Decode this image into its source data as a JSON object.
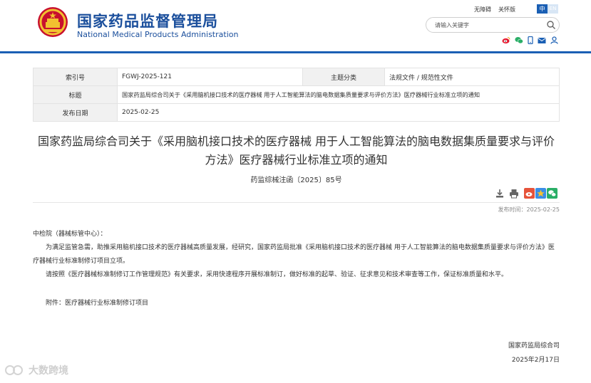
{
  "header": {
    "title_cn": "国家药品监督管理局",
    "title_en": "National Medical Products Administration",
    "link_accessibility": "无障碍",
    "link_old_version": "关怀版",
    "lang_zh": "中",
    "lang_en": "EN",
    "search_placeholder": "请输入关键字",
    "brand_color": "#1b4f9c"
  },
  "info": {
    "index_label": "索引号",
    "index_value": "FGWJ-2025-121",
    "category_label": "主题分类",
    "category_value": "法规文件 / 规范性文件",
    "subject_label": "标题",
    "subject_value": "国家药监局综合司关于《采用脑机接口技术的医疗器械 用于人工智能算法的脑电数据集质量要求与评价方法》医疗器械行业标准立项的通知",
    "date_label": "发布日期",
    "date_value": "2025-02-25"
  },
  "article": {
    "title_line1": "国家药监局综合司关于《采用脑机接口技术的医疗器械 用于人工智能算法的脑电数据集质量要求与评价",
    "title_line2": "方法》医疗器械行业标准立项的通知",
    "doc_number": "药监综械注函〔2025〕85号",
    "publish_time": "发布时间：2025-02-25",
    "salutation": "中检院（器械标管中心）：",
    "paragraph1": "为满足监管急需，助推采用脑机接口技术的医疗器械高质量发展，经研究，国家药监局批准《采用脑机接口技术的医疗器械 用于人工智能算法的脑电数据集质量要求与评价方法》医疗器械行业标准制修订项目立项。",
    "paragraph2": "请按照《医疗器械标准制修订工作管理规范》有关要求，采用快速程序开展标准制订，做好标准的起草、验证、征求意见和技术审查等工作，保证标准质量和水平。",
    "attachment": "附件：医疗器械行业标准制修订项目",
    "signature_org": "国家药监局综合司",
    "signature_date": "2025年2月17日"
  },
  "icons": {
    "social": [
      "weibo-icon",
      "wechat-icon",
      "mobile-icon",
      "mail-icon",
      "user-icon"
    ],
    "tools": [
      "download-icon",
      "print-icon"
    ],
    "share": [
      "weibo-share-icon",
      "qzone-share-icon",
      "wechat-share-icon"
    ]
  },
  "watermark": {
    "text": "大数跨境"
  }
}
